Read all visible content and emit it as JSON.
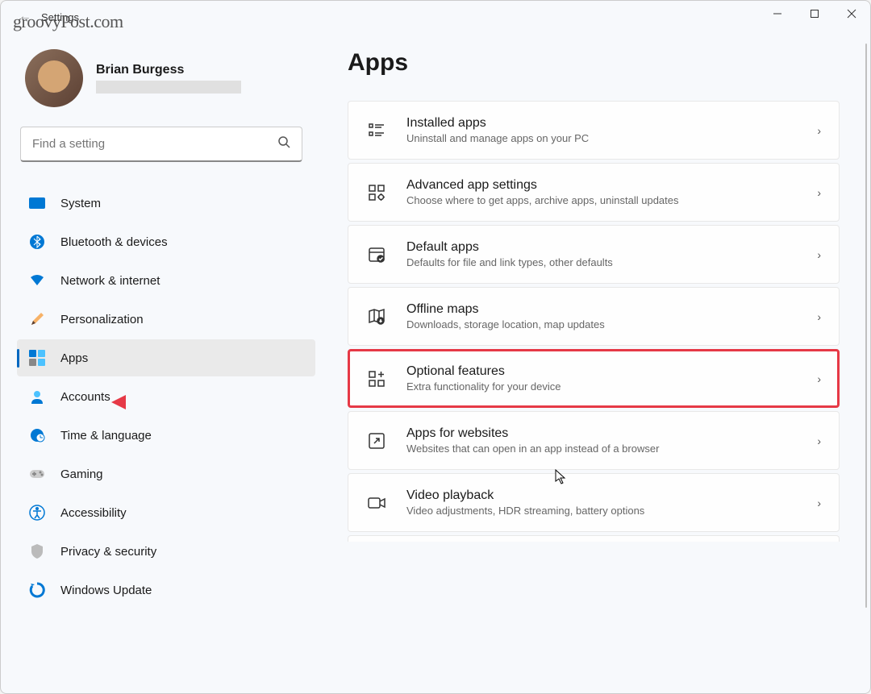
{
  "watermark": "groovyPost.com",
  "titlebar": {
    "title": "Settings"
  },
  "profile": {
    "name": "Brian Burgess"
  },
  "search": {
    "placeholder": "Find a setting"
  },
  "nav": {
    "items": [
      {
        "label": "System"
      },
      {
        "label": "Bluetooth & devices"
      },
      {
        "label": "Network & internet"
      },
      {
        "label": "Personalization"
      },
      {
        "label": "Apps"
      },
      {
        "label": "Accounts"
      },
      {
        "label": "Time & language"
      },
      {
        "label": "Gaming"
      },
      {
        "label": "Accessibility"
      },
      {
        "label": "Privacy & security"
      },
      {
        "label": "Windows Update"
      }
    ]
  },
  "page": {
    "title": "Apps"
  },
  "settings": {
    "items": [
      {
        "title": "Installed apps",
        "desc": "Uninstall and manage apps on your PC"
      },
      {
        "title": "Advanced app settings",
        "desc": "Choose where to get apps, archive apps, uninstall updates"
      },
      {
        "title": "Default apps",
        "desc": "Defaults for file and link types, other defaults"
      },
      {
        "title": "Offline maps",
        "desc": "Downloads, storage location, map updates"
      },
      {
        "title": "Optional features",
        "desc": "Extra functionality for your device"
      },
      {
        "title": "Apps for websites",
        "desc": "Websites that can open in an app instead of a browser"
      },
      {
        "title": "Video playback",
        "desc": "Video adjustments, HDR streaming, battery options"
      }
    ]
  }
}
